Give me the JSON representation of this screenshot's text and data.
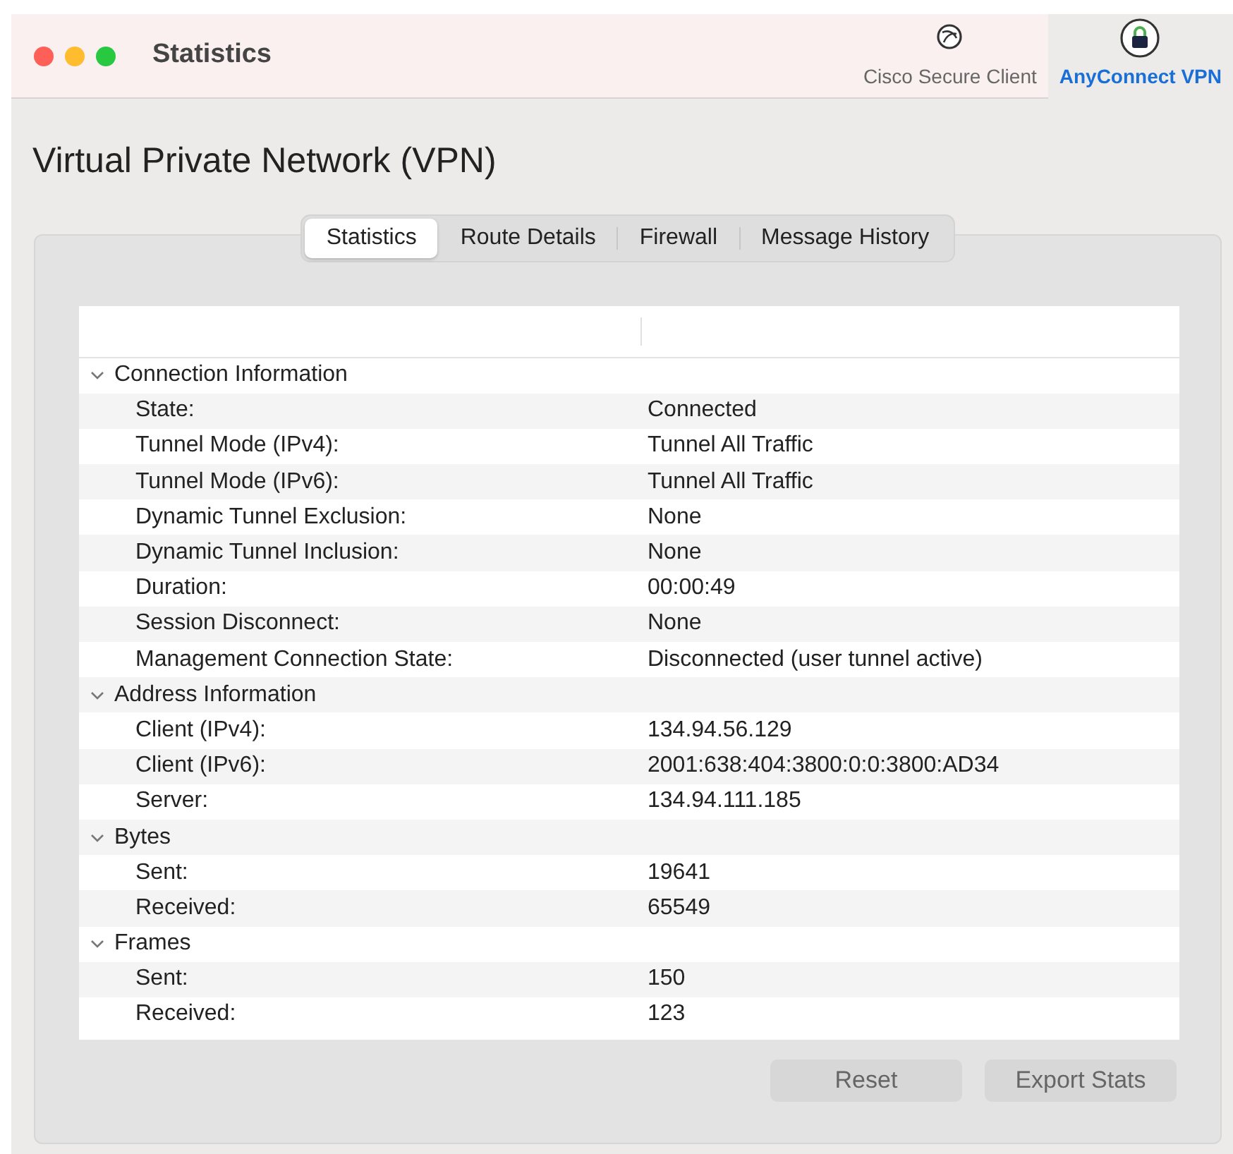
{
  "window": {
    "title": "Statistics"
  },
  "toolbar": [
    {
      "label": "Cisco Secure Client",
      "selected": false
    },
    {
      "label": "AnyConnect VPN",
      "selected": true
    }
  ],
  "heading": "Virtual Private Network (VPN)",
  "tabs": [
    {
      "label": "Statistics",
      "selected": true
    },
    {
      "label": "Route Details",
      "selected": false
    },
    {
      "label": "Firewall",
      "selected": false
    },
    {
      "label": "Message History",
      "selected": false
    }
  ],
  "table": {
    "groups": [
      {
        "label": "Connection Information",
        "expanded": true,
        "rows": [
          [
            "State:",
            "Connected"
          ],
          [
            "Tunnel Mode (IPv4):",
            "Tunnel All Traffic"
          ],
          [
            "Tunnel Mode (IPv6):",
            "Tunnel All Traffic"
          ],
          [
            "Dynamic Tunnel Exclusion:",
            "None"
          ],
          [
            "Dynamic Tunnel Inclusion:",
            "None"
          ],
          [
            "Duration:",
            "00:00:49"
          ],
          [
            "Session Disconnect:",
            "None"
          ],
          [
            "Management Connection State:",
            "Disconnected (user tunnel active)"
          ]
        ]
      },
      {
        "label": "Address Information",
        "expanded": true,
        "rows": [
          [
            "Client (IPv4):",
            "134.94.56.129"
          ],
          [
            "Client (IPv6):",
            "2001:638:404:3800:0:0:3800:AD34"
          ],
          [
            "Server:",
            "134.94.111.185"
          ]
        ]
      },
      {
        "label": "Bytes",
        "expanded": true,
        "rows": [
          [
            "Sent:",
            "19641"
          ],
          [
            "Received:",
            "65549"
          ]
        ]
      },
      {
        "label": "Frames",
        "expanded": true,
        "rows": [
          [
            "Sent:",
            "150"
          ],
          [
            "Received:",
            "123"
          ]
        ]
      }
    ]
  },
  "buttons": [
    {
      "label": "Reset",
      "disabled": true
    },
    {
      "label": "Export Stats",
      "disabled": true
    }
  ]
}
